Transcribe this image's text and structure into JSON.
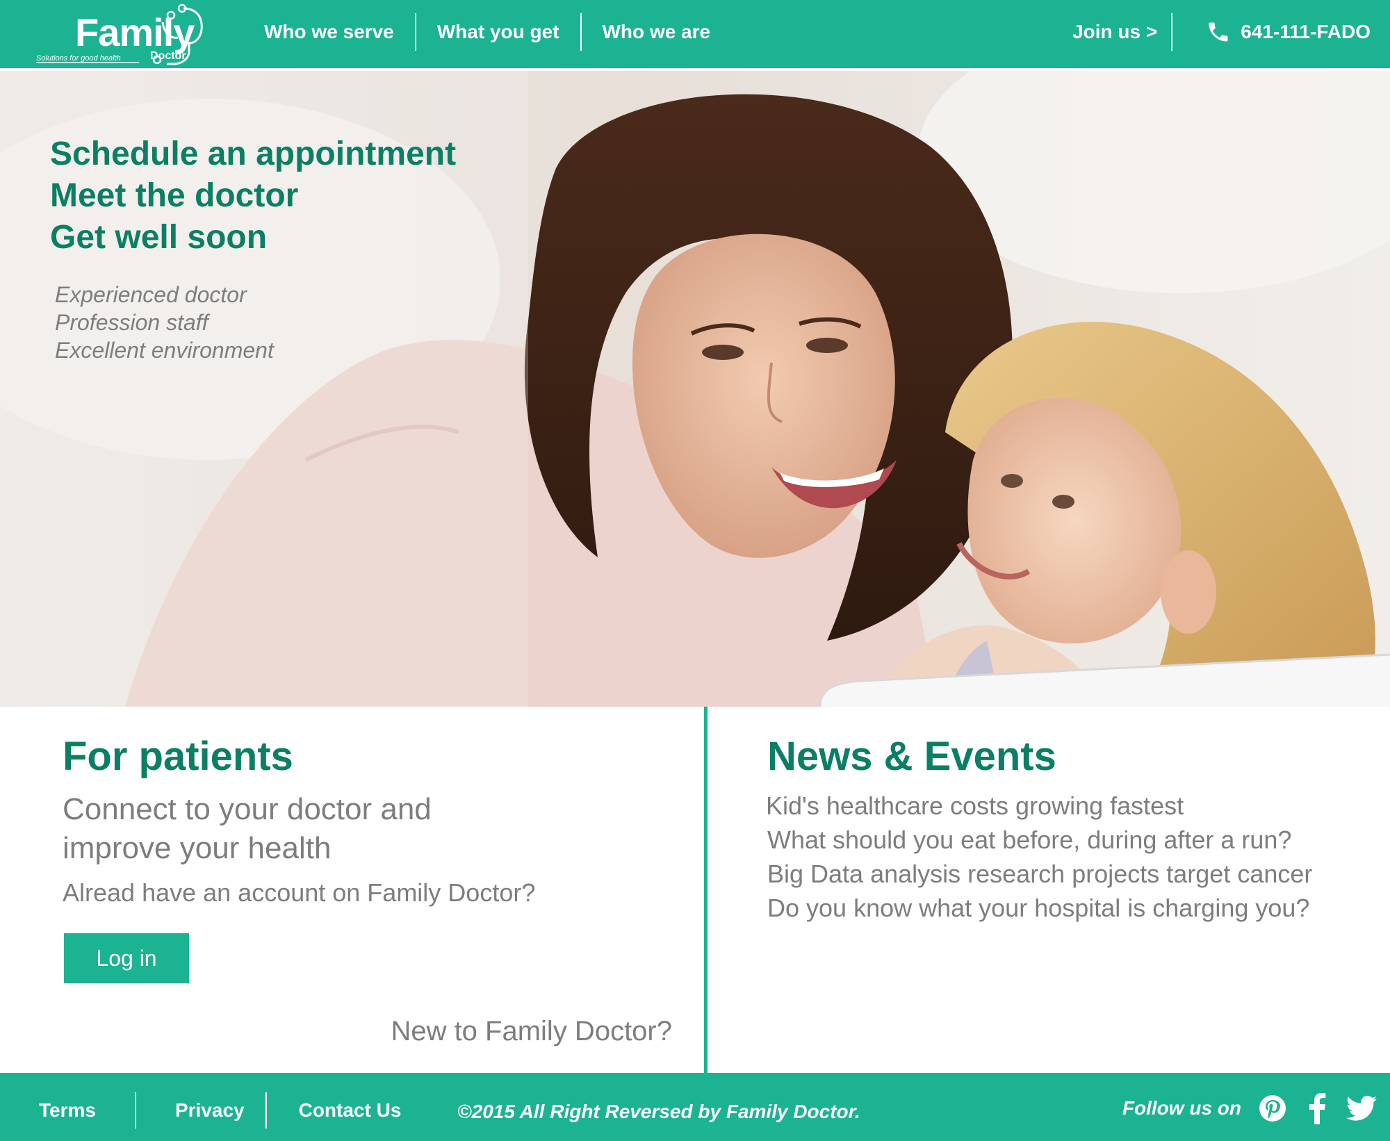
{
  "colors": {
    "brand": "#1cb393",
    "heading": "#0a7f63",
    "muted": "#7d7d7d"
  },
  "header": {
    "logo": {
      "word": "Family",
      "sub": "Doctor",
      "tagline": "Solutions for good health"
    },
    "nav": [
      "Who we serve",
      "What you get",
      "Who we are"
    ],
    "join": "Join us >",
    "phone": "641-111-FADO"
  },
  "hero": {
    "headlines": [
      "Schedule an appointment",
      "Meet the doctor",
      "Get well soon"
    ],
    "features": [
      "Experienced doctor",
      "Profession staff",
      "Excellent environment"
    ]
  },
  "patients": {
    "title": "For patients",
    "desc_line1": "Connect to your doctor and",
    "desc_line2": "improve your health",
    "account_prompt": "Alread have an account on Family Doctor?",
    "login": "Log in",
    "new_prompt": "New to Family Doctor?"
  },
  "news": {
    "title": "News & Events",
    "items": [
      "Kid's healthcare costs growing fastest",
      "What should you eat before, during after a run?",
      "Big Data analysis research projects target cancer",
      "Do you know what your hospital is charging you?"
    ]
  },
  "footer": {
    "links": [
      "Terms",
      "Privacy",
      "Contact Us"
    ],
    "copyright": "©2015 All Right Reversed by Family Doctor.",
    "follow": "Follow us on",
    "social": [
      "pinterest-icon",
      "facebook-icon",
      "twitter-icon"
    ]
  }
}
